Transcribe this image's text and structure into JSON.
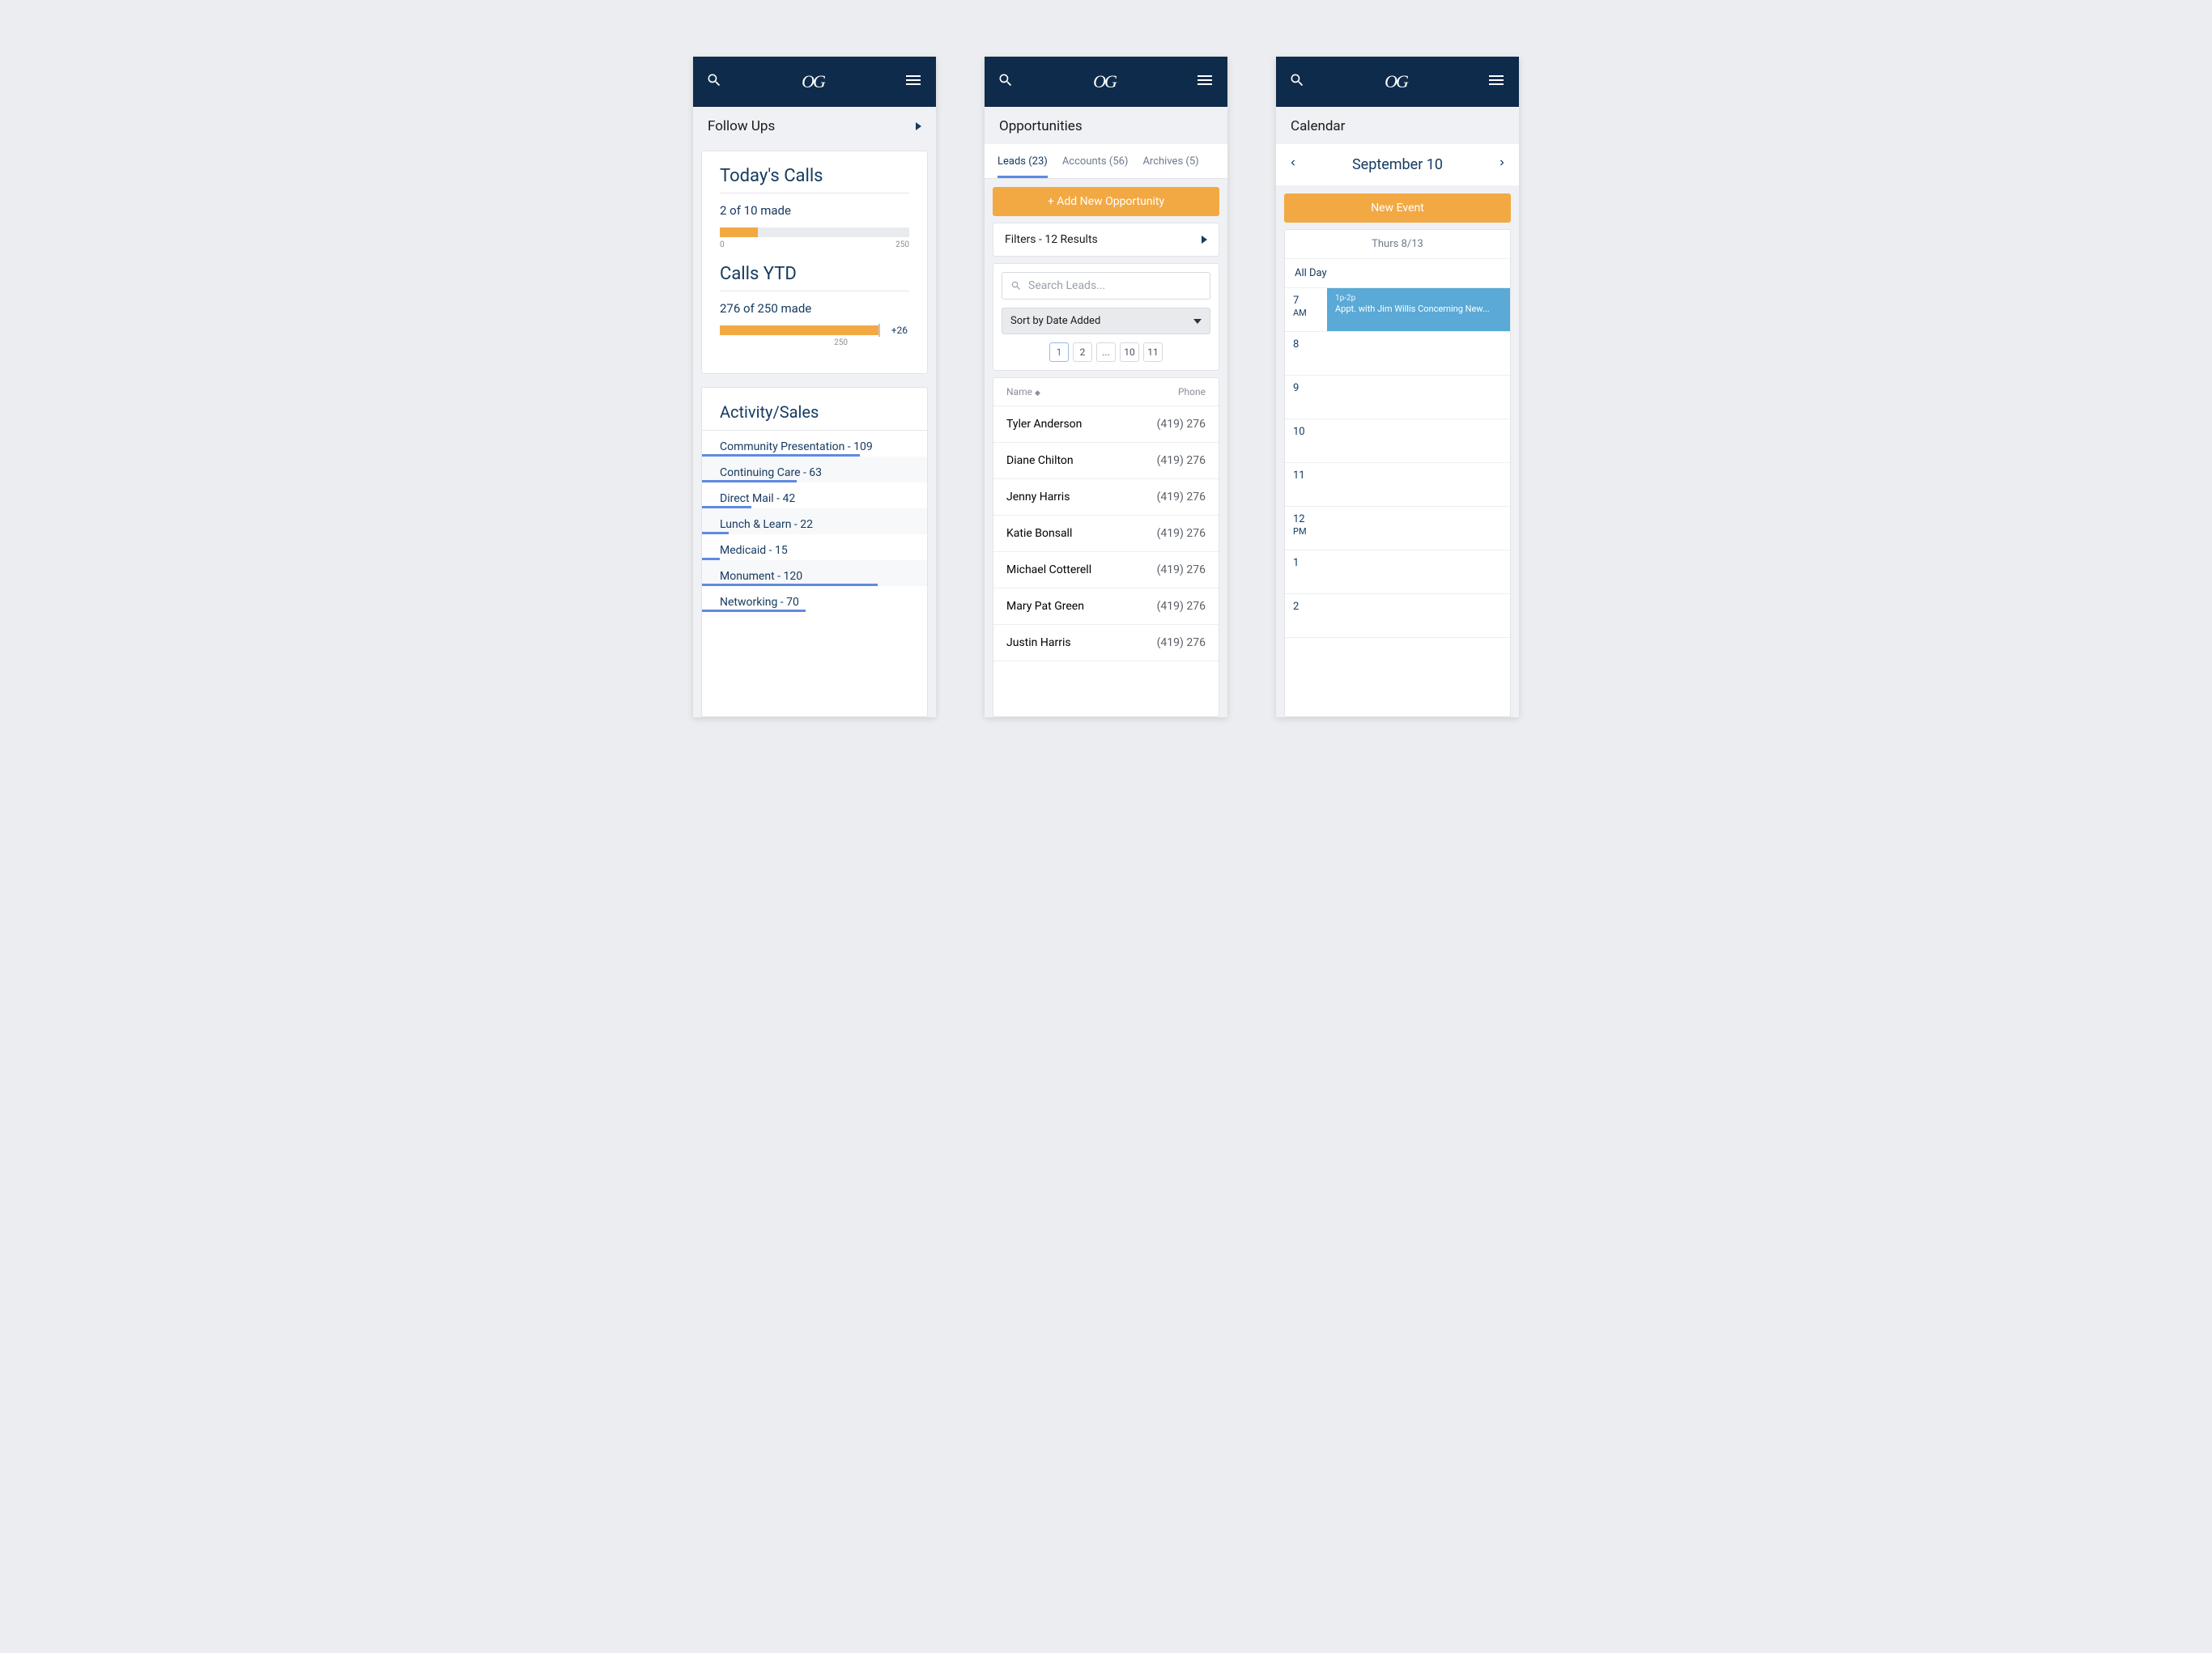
{
  "colors": {
    "navy": "#0f2b4b",
    "orange": "#f2a943",
    "blue": "#5f8ae0",
    "skyblue": "#5aa9d6"
  },
  "logo": "OG",
  "followups": {
    "header": "Follow Ups",
    "todays_calls_title": "Today's Calls",
    "todays_calls_stat": "2 of 10 made",
    "todays_calls_min": "0",
    "todays_calls_max": "250",
    "calls_ytd_title": "Calls YTD",
    "calls_ytd_stat": "276 of 250 made",
    "calls_ytd_over": "+26",
    "calls_ytd_max": "250",
    "activity_title": "Activity/Sales",
    "activities": [
      {
        "label": "Community Presentation - 109",
        "pct": 70
      },
      {
        "label": "Continuing Care - 63",
        "pct": 42
      },
      {
        "label": "Direct Mail -  42",
        "pct": 22
      },
      {
        "label": "Lunch & Learn - 22",
        "pct": 12
      },
      {
        "label": "Medicaid - 15",
        "pct": 8
      },
      {
        "label": "Monument - 120",
        "pct": 78
      },
      {
        "label": "Networking - 70",
        "pct": 46
      }
    ]
  },
  "opportunities": {
    "header": "Opportunities",
    "tabs": [
      {
        "label": "Leads (23)",
        "active": true
      },
      {
        "label": "Accounts (56)",
        "active": false
      },
      {
        "label": "Archives (5)",
        "active": false
      }
    ],
    "add_button": "+ Add New Opportunity",
    "filter_label": "Filters - 12 Results",
    "search_placeholder": "Search Leads...",
    "sort_label": "Sort by Date Added",
    "pages": [
      "1",
      "2",
      "...",
      "10",
      "11"
    ],
    "name_col": "Name",
    "phone_col": "Phone",
    "rows": [
      {
        "name": "Tyler Anderson",
        "phone": "(419) 276"
      },
      {
        "name": "Diane Chilton",
        "phone": "(419) 276"
      },
      {
        "name": "Jenny Harris",
        "phone": "(419) 276"
      },
      {
        "name": "Katie Bonsall",
        "phone": "(419) 276"
      },
      {
        "name": "Michael Cotterell",
        "phone": "(419) 276"
      },
      {
        "name": "Mary Pat Green",
        "phone": "(419) 276"
      },
      {
        "name": "Justin Harris",
        "phone": "(419) 276"
      }
    ]
  },
  "calendar": {
    "header": "Calendar",
    "date_title": "September 10",
    "new_event_btn": "New Event",
    "day_header": "Thurs 8/13",
    "all_day_label": "All Day",
    "event_time": "1p-2p",
    "event_title": "Appt. with Jim Willis Concerning New...",
    "hours": [
      {
        "lbl": "7",
        "ampm": "AM"
      },
      {
        "lbl": "8",
        "ampm": ""
      },
      {
        "lbl": "9",
        "ampm": ""
      },
      {
        "lbl": "10",
        "ampm": ""
      },
      {
        "lbl": "11",
        "ampm": ""
      },
      {
        "lbl": "12",
        "ampm": "PM"
      },
      {
        "lbl": "1",
        "ampm": ""
      },
      {
        "lbl": "2",
        "ampm": ""
      }
    ]
  }
}
